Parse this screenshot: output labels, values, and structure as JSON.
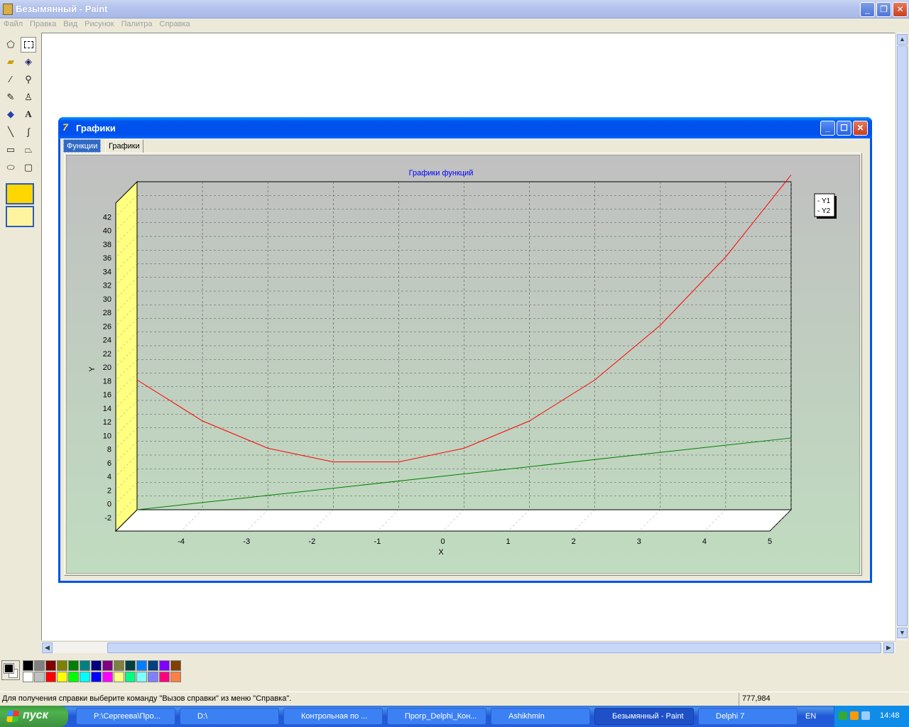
{
  "app": {
    "title": "Безымянный - Paint"
  },
  "menu": [
    "Файл",
    "Правка",
    "Вид",
    "Рисунок",
    "Палитра",
    "Справка"
  ],
  "status": {
    "help": "Для получения справки выберите команду \"Вызов справки\" из меню \"Справка\".",
    "coords": "777,984"
  },
  "palette": {
    "foreground": "#000000",
    "background": "#ffffff",
    "colors": [
      "#000000",
      "#808080",
      "#800000",
      "#808000",
      "#008000",
      "#008080",
      "#000080",
      "#800080",
      "#808040",
      "#004040",
      "#0080ff",
      "#004080",
      "#8000ff",
      "#804000",
      "#ffffff",
      "#c0c0c0",
      "#ff0000",
      "#ffff00",
      "#00ff00",
      "#00ffff",
      "#0000ff",
      "#ff00ff",
      "#ffff80",
      "#00ff80",
      "#80ffff",
      "#8080ff",
      "#ff0080",
      "#ff8040"
    ]
  },
  "dialog": {
    "title": "Графики",
    "tabs": [
      "Функции",
      "Графики"
    ],
    "active_tab": "Графики"
  },
  "chart_data": {
    "type": "line",
    "title": "Графики функций",
    "xlabel": "X",
    "ylabel": "Y",
    "xlim": [
      -5,
      5
    ],
    "ylim": [
      -4,
      44
    ],
    "x_ticks": [
      -4,
      -3,
      -2,
      -1,
      0,
      1,
      2,
      3,
      4,
      5
    ],
    "y_ticks": [
      -2,
      0,
      2,
      4,
      6,
      8,
      10,
      12,
      14,
      16,
      18,
      20,
      22,
      24,
      26,
      28,
      30,
      32,
      34,
      36,
      38,
      40,
      42
    ],
    "grid": true,
    "legend_position": "top-right",
    "background": {
      "top": "#c0c0c0",
      "bottom": "#c0dcc0"
    },
    "series": [
      {
        "name": "Y1",
        "color": "#ff0000",
        "x": [
          -5,
          -4,
          -3,
          -2,
          -1,
          0,
          1,
          2,
          3,
          4,
          5
        ],
        "y": [
          15,
          9,
          5,
          3,
          3,
          5,
          9,
          15,
          23,
          33,
          45
        ]
      },
      {
        "name": "Y2",
        "color": "#008000",
        "x": [
          -5,
          5
        ],
        "y": [
          -4,
          6.5
        ]
      }
    ]
  },
  "taskbar": {
    "start_label": "пуск",
    "tasks": [
      "P:\\Сергеева\\Про...",
      "D:\\",
      "Контрольная по ...",
      "Прогр_Delphi_Кон...",
      "Ashikhmin",
      "Безымянный - Paint",
      "Delphi 7"
    ],
    "active_task": "Безымянный - Paint",
    "language": "EN",
    "clock": "14:48"
  },
  "icons": [
    "free-select-icon",
    "select-icon",
    "eraser-icon",
    "fill-icon",
    "picker-icon",
    "magnifier-icon",
    "pencil-icon",
    "brush-icon",
    "airbrush-icon",
    "text-icon",
    "line-icon",
    "curve-icon",
    "rectangle-icon",
    "polygon-icon",
    "ellipse-icon",
    "rounded-rect-icon"
  ]
}
